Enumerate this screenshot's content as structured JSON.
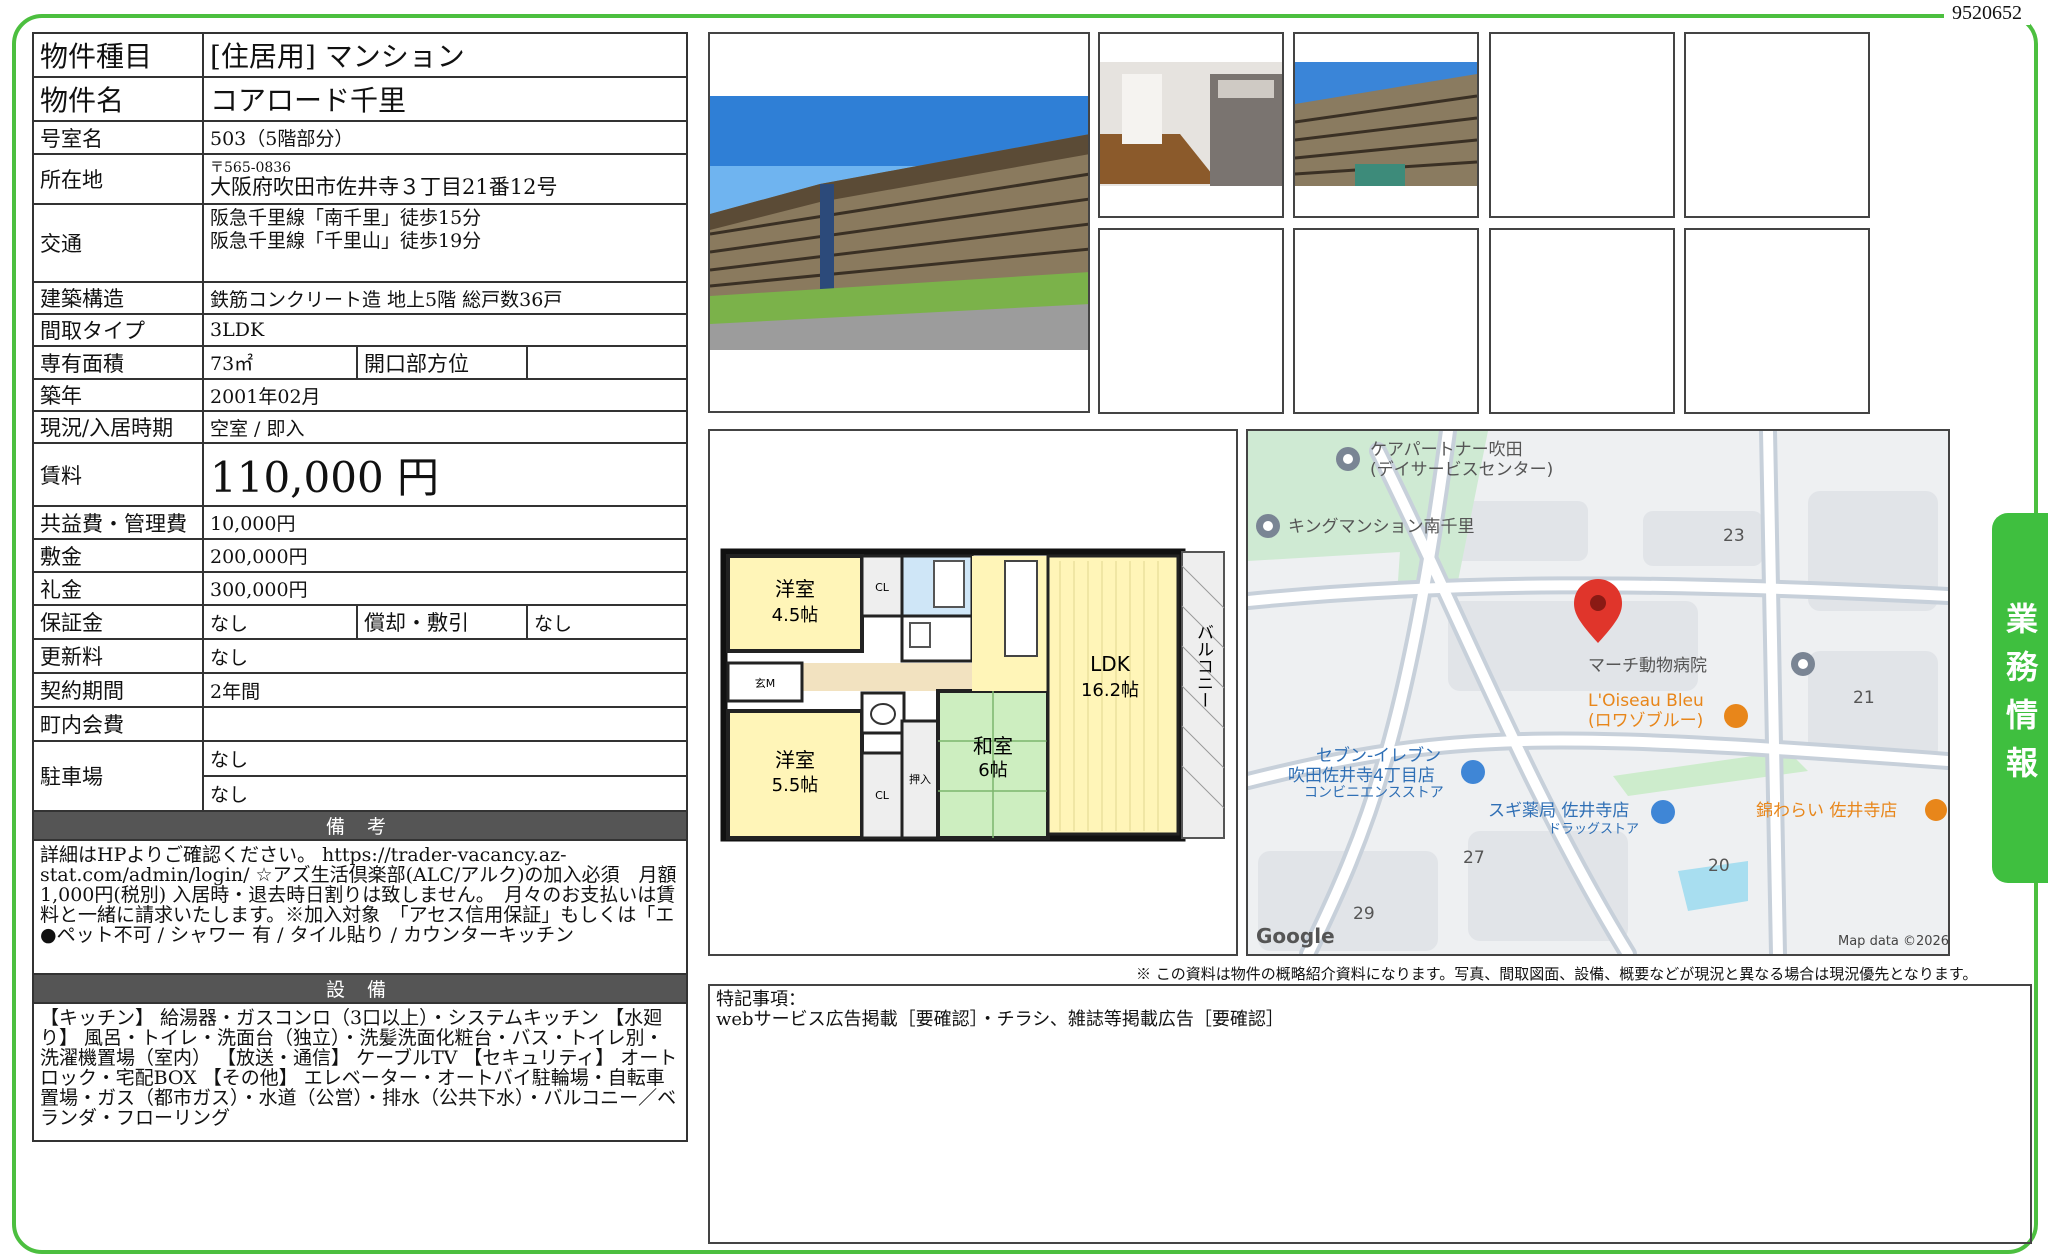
{
  "doc_id": "9520652",
  "side_tab": "業務情報",
  "info": {
    "type_label": "物件種目",
    "type_value": "[住居用]  マンション",
    "name_label": "物件名",
    "name_value": "コアロード千里",
    "room_label": "号室名",
    "room_value": "503（5階部分）",
    "addr_label": "所在地",
    "addr_zip": "〒565-0836",
    "addr_value": "大阪府吹田市佐井寺３丁目21番12号",
    "access_label": "交通",
    "access_1": "阪急千里線「南千里」徒歩15分",
    "access_2": "阪急千里線「千里山」徒歩19分",
    "struct_label": "建築構造",
    "struct_value": "鉄筋コンクリート造 地上5階 総戸数36戸",
    "layout_label": "間取タイプ",
    "layout_value": "3LDK",
    "area_label": "専有面積",
    "area_value": "73㎡",
    "dir_label": "開口部方位",
    "dir_value": "",
    "built_label": "築年",
    "built_value": "2001年02月",
    "status_label": "現況/入居時期",
    "status_value": "空室 / 即入",
    "rent_label": "賃料",
    "rent_value": "110,000 円",
    "fee_label": "共益費・管理費",
    "fee_value": "10,000円",
    "deposit_label": "敷金",
    "deposit_value": "200,000円",
    "key_label": "礼金",
    "key_value": "300,000円",
    "guarantee_label": "保証金",
    "guarantee_value": "なし",
    "amort_label": "償却・敷引",
    "amort_value": "なし",
    "renew_label": "更新料",
    "renew_value": "なし",
    "contract_label": "契約期間",
    "contract_value": "2年間",
    "town_label": "町内会費",
    "town_value": "",
    "parking_label": "駐車場",
    "parking_1": "なし",
    "parking_2": "なし"
  },
  "notes": {
    "title": "備 考",
    "text": "詳細はHPよりご確認ください。 https://trader-vacancy.az-stat.com/admin/login/ ☆アズ生活倶楽部(ALC/アルク)の加入必須　月額1,000円(税別) 入居時・退去時日割りは致しません。　月々のお支払いは賃料と一緒に請求いたします。※加入対象　「アセス信用保証」もしくは「エ",
    "features": "●ペット不可 / シャワー 有 / タイル貼り / カウンターキッチン"
  },
  "equipment": {
    "title": "設 備",
    "text": "【キッチン】 給湯器・ガスコンロ（3口以上）・システムキッチン 【水廻り】 風呂・トイレ・洗面台（独立）・洗髪洗面化粧台・バス・トイレ別・洗濯機置場（室内） 【放送・通信】 ケーブルTV 【セキュリティ】 オートロック・宅配BOX 【その他】 エレベーター・オートバイ駐輪場・自転車置場・ガス（都市ガス）・水道（公営）・排水（公共下水）・バルコニー／ベランダ・フローリング"
  },
  "floorplan": {
    "room1": "洋室",
    "room1_size": "4.5帖",
    "room2": "洋室",
    "room2_size": "5.5帖",
    "room3": "和室",
    "room3_size": "6帖",
    "ldk": "LDK",
    "ldk_size": "16.2帖",
    "balcony": "バルコニー",
    "cl": "CL",
    "oshiire": "押入",
    "genkan": "玄M"
  },
  "map": {
    "poi1": "ケアパートナー吹田",
    "poi1_sub": "(デイサービスセンター)",
    "poi2": "キングマンション南千里",
    "poi3": "マーチ動物病院",
    "poi4": "L'Oiseau Bleu",
    "poi4_sub": "(ロワゾブルー)",
    "poi5": "セブン-イレブン",
    "poi5_sub": "吹田佐井寺4丁目店",
    "poi5_sub2": "コンビニエンスストア",
    "poi6": "スギ薬局 佐井寺店",
    "poi6_sub": "ドラッグストア",
    "poi7": "錦わらい 佐井寺店",
    "n23": "23",
    "n21": "21",
    "n27": "27",
    "n20": "20",
    "n29": "29",
    "google": "Google",
    "mapdata": "Map data ©2026"
  },
  "disclaimer": "※ この資料は物件の概略紹介資料になります。写真、間取図面、設備、概要などが現況と異なる場合は現況優先となります。",
  "remarks": {
    "label": "特記事項：",
    "text": "webサービス広告掲載［要確認］・チラシ、雑誌等掲載広告［要確認］"
  },
  "colors": {
    "frame": "#4cbf3f",
    "section_bg": "#555555",
    "map_pin": "#e0352b",
    "map_orange": "#e8861a"
  }
}
